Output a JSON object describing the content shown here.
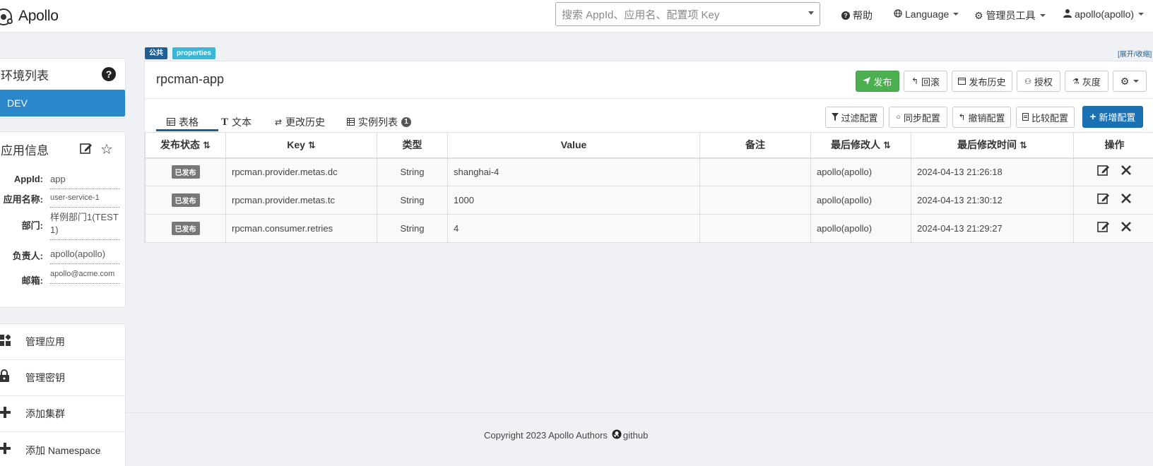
{
  "navbar": {
    "brand": "Apollo",
    "search_placeholder": "搜索 AppId、应用名、配置项 Key",
    "help": "帮助",
    "language": "Language",
    "admin_tools": "管理员工具",
    "user": "apollo(apollo)"
  },
  "sidebar": {
    "env_title": "环境列表",
    "env_selected": "DEV",
    "info_title": "应用信息",
    "info": [
      {
        "label": "AppId:",
        "value": "app"
      },
      {
        "label": "应用名称:",
        "value": "user-service-1"
      },
      {
        "label": "部门:",
        "value": "样例部门1(TEST1)"
      },
      {
        "label": "负责人:",
        "value": "apollo(apollo)"
      },
      {
        "label": "邮箱:",
        "value": "apollo@acme.com"
      }
    ],
    "menu": [
      {
        "label": "管理应用"
      },
      {
        "label": "管理密钥"
      },
      {
        "label": "添加集群"
      },
      {
        "label": "添加 Namespace"
      }
    ]
  },
  "namespace": {
    "tag_public": "公共",
    "tag_format": "properties",
    "expand_collapse": "[展开/收缩]",
    "name": "rpcman-app",
    "buttons": {
      "publish": "发布",
      "rollback": "回滚",
      "publish_history": "发布历史",
      "grant": "授权",
      "gray": "灰度"
    },
    "tabs": {
      "table": "表格",
      "text": "文本",
      "history": "更改历史",
      "instances": "实例列表",
      "instances_count": "1"
    },
    "actions": {
      "filter": "过滤配置",
      "sync": "同步配置",
      "revoke": "撤销配置",
      "compare": "比较配置",
      "add": "新增配置"
    },
    "columns": [
      "发布状态",
      "Key",
      "类型",
      "Value",
      "备注",
      "最后修改人",
      "最后修改时间",
      "操作"
    ],
    "rows": [
      {
        "status": "已发布",
        "key": "rpcman.provider.metas.dc",
        "type": "String",
        "value": "shanghai-4",
        "comment": "",
        "modifier": "apollo(apollo)",
        "time": "2024-04-13 21:26:18"
      },
      {
        "status": "已发布",
        "key": "rpcman.provider.metas.tc",
        "type": "String",
        "value": "1000",
        "comment": "",
        "modifier": "apollo(apollo)",
        "time": "2024-04-13 21:30:12"
      },
      {
        "status": "已发布",
        "key": "rpcman.consumer.retries",
        "type": "String",
        "value": "4",
        "comment": "",
        "modifier": "apollo(apollo)",
        "time": "2024-04-13 21:29:27"
      }
    ]
  },
  "footer": {
    "copyright": "Copyright 2023 Apollo Authors",
    "github": "github"
  }
}
